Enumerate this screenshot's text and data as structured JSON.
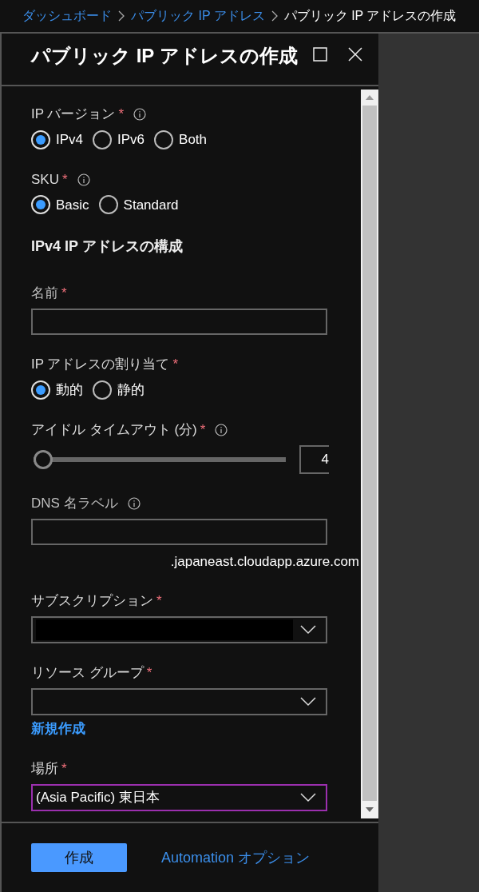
{
  "breadcrumb": [
    {
      "label": "ダッシュボード",
      "kind": "link"
    },
    {
      "label": "パブリック IP アドレス",
      "kind": "link"
    },
    {
      "label": "パブリック IP アドレスの作成",
      "kind": "current"
    }
  ],
  "panel": {
    "title": "パブリック IP アドレスの作成"
  },
  "form": [
    {
      "kind": "radio",
      "label": "IP バージョン",
      "required_mark": "*",
      "info": true,
      "options": [
        {
          "label": "IPv4",
          "selected": true
        },
        {
          "label": "IPv6",
          "selected": false
        },
        {
          "label": "Both",
          "selected": false
        }
      ]
    },
    {
      "kind": "radio",
      "label": "SKU",
      "required_mark": "*",
      "info": true,
      "options": [
        {
          "label": "Basic",
          "selected": true
        },
        {
          "label": "Standard",
          "selected": false
        }
      ]
    },
    {
      "kind": "heading",
      "label": "IPv4 IP アドレスの構成"
    },
    {
      "kind": "text",
      "label": "名前",
      "required_mark": "*"
    },
    {
      "kind": "radio",
      "label": "IP アドレスの割り当て",
      "required_mark": "*",
      "options": [
        {
          "label": "動的",
          "selected": true
        },
        {
          "label": "静的",
          "selected": false
        }
      ]
    },
    {
      "kind": "slider",
      "label": "アイドル タイムアウト (分)",
      "required_mark": "*",
      "info": true,
      "level": 0,
      "value": "4"
    },
    {
      "kind": "text",
      "label": "DNS 名ラベル",
      "info": true,
      "suffix": ".japaneast.cloudapp.azure.com"
    },
    {
      "kind": "dropdown",
      "label": "サブスクリプション",
      "required_mark": "*",
      "redacted": true
    },
    {
      "kind": "dropdown",
      "label": "リソース グループ",
      "required_mark": "*",
      "link": "新規作成"
    },
    {
      "kind": "dropdown",
      "label": "場所",
      "required_mark": "*",
      "value": "(Asia Pacific) 東日本",
      "focused": true
    }
  ],
  "footer": {
    "primary": "作成",
    "link": "Automation オプション"
  }
}
